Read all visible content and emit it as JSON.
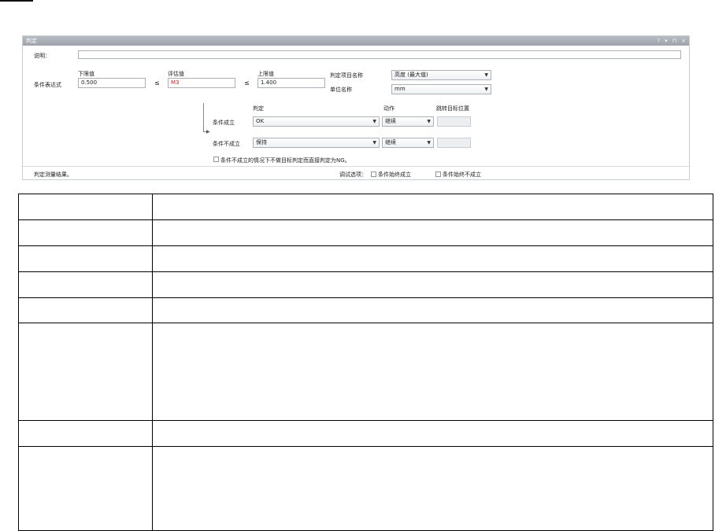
{
  "panel": {
    "title": "判定",
    "controls": [
      "?",
      "▾",
      "⊓",
      "×"
    ],
    "description_label": "说明：",
    "description_value": "",
    "condition_label": "条件表达式",
    "lower": {
      "label": "下限值",
      "value": "0.500"
    },
    "leq_symbol": "≤",
    "evaluation": {
      "label": "评估值",
      "value": "M3"
    },
    "upper": {
      "label": "上限值",
      "value": "1.400"
    },
    "item_name_label": "判定项目名称",
    "item_name_value": "高度 (最大值)",
    "unit_label": "单位名称",
    "unit_value": "mm",
    "judge_col": "判定",
    "action_col": "动作",
    "target_col": "跳转目标位置",
    "met_label": "条件成立",
    "met_judge": "OK",
    "met_action": "继续",
    "unmet_label": "条件不成立",
    "unmet_judge": "保持",
    "unmet_action": "继续",
    "ng_option_label": "条件不成立的情况下不做目标判定而直接判定为NG。",
    "status_text": "判定测量结果。",
    "debug_label": "调试选项：",
    "debug_always_met": "条件始终成立",
    "debug_always_unmet": "条件始终不成立"
  },
  "table": {
    "rows": [
      {
        "a": "",
        "b": ""
      },
      {
        "a": "",
        "b": ""
      },
      {
        "a": "",
        "b": ""
      },
      {
        "a": "",
        "b": ""
      },
      {
        "a": "",
        "b": ""
      },
      {
        "a": "",
        "b": ""
      },
      {
        "a": "",
        "b": ""
      },
      {
        "a": "",
        "b": ""
      }
    ]
  },
  "icons": {
    "dropdown": "chevron-down-icon",
    "branch": "arrow-right-icon"
  },
  "colors": {
    "titlebar": "#a7adb4",
    "eval_value": "#d9201e",
    "border": "#aab0b7"
  }
}
